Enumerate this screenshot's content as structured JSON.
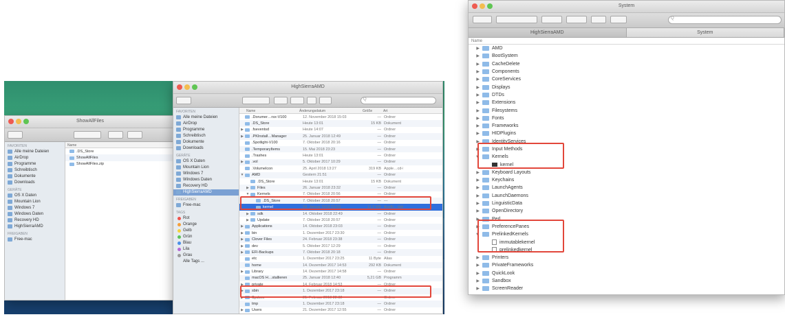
{
  "left_screenshot": {
    "window_small": {
      "title": "ShowAllFiles",
      "sidebar_headers": [
        "FAVORITEN",
        "GERÄTE",
        "FREIGABEN"
      ],
      "favorites": [
        "Alle meine Dateien",
        "AirDrop",
        "Programme",
        "Schreibtisch",
        "Dokumente",
        "Downloads"
      ],
      "devices": [
        "OS X Daten",
        "Mountain Lion",
        "Windows 7",
        "Windows Daten",
        "Recovery HD",
        "HighSierraAMD"
      ],
      "shared": [
        "Free-mac"
      ],
      "list_header": "Name",
      "files": [
        ".DS_Store",
        "ShowAllFiles",
        "ShowAllFiles.zip"
      ]
    },
    "window_main": {
      "title": "HighSierraAMD",
      "search_placeholder": "Q",
      "sidebar_headers": [
        "FAVORITEN",
        "GERÄTE",
        "FREIGABEN",
        "TAGS"
      ],
      "favorites": [
        "Alle meine Dateien",
        "AirDrop",
        "Programme",
        "Schreibtisch",
        "Dokumente",
        "Downloads"
      ],
      "devices": [
        "OS X Daten",
        "Mountain Lion",
        "Windows 7",
        "Windows Daten",
        "Recovery HD",
        "HighSierraAMD"
      ],
      "shared": [
        "Free-mac"
      ],
      "tags": [
        {
          "label": "Rot",
          "color": "#f0524a"
        },
        {
          "label": "Orange",
          "color": "#f5a03a"
        },
        {
          "label": "Gelb",
          "color": "#f3d13d"
        },
        {
          "label": "Grün",
          "color": "#5cc35a"
        },
        {
          "label": "Blau",
          "color": "#4a8fe7"
        },
        {
          "label": "Lila",
          "color": "#b569d6"
        },
        {
          "label": "Grau",
          "color": "#9a9a9a"
        },
        {
          "label": "Alle Tags ...",
          "color": ""
        }
      ],
      "columns": [
        "Name",
        "Änderungsdatum",
        "Größe",
        "Art"
      ],
      "rows": [
        {
          "name": ".Dorumer…rsx-V100",
          "date": "12. November 2018 15:03",
          "size": "—",
          "kind": "Ordner",
          "disclosure": ""
        },
        {
          "name": ".DS_Store",
          "date": "Heute 13:01",
          "size": "15 KB",
          "kind": "Dokument",
          "disclosure": ""
        },
        {
          "name": ".fseventsd",
          "date": "Heute 14:07",
          "size": "—",
          "kind": "Ordner",
          "disclosure": "▶"
        },
        {
          "name": ".PKInstall…Manager",
          "date": "25. Januar 2018 12:49",
          "size": "—",
          "kind": "Ordner",
          "disclosure": "▶"
        },
        {
          "name": ".Spotlight-V100",
          "date": "7. Oktober 2018 20:16",
          "size": "—",
          "kind": "Ordner",
          "disclosure": ""
        },
        {
          "name": ".TemporaryItems",
          "date": "15. Mai 2018 23:23",
          "size": "—",
          "kind": "Ordner",
          "disclosure": ""
        },
        {
          "name": ".Trashes",
          "date": "Heute 13:01",
          "size": "—",
          "kind": "Ordner",
          "disclosure": ""
        },
        {
          "name": ".vol",
          "date": "5. Oktober 2017 10:29",
          "size": "—",
          "kind": "Ordner",
          "disclosure": "▶"
        },
        {
          "name": ".VolumeIcon",
          "date": "25. April 2018 13:27",
          "size": "319 KB",
          "kind": "Apple…cd-Bild",
          "disclosure": ""
        },
        {
          "name": "AMD",
          "date": "Gestern 21:51",
          "size": "—",
          "kind": "Ordner",
          "disclosure": "▼"
        },
        {
          "name": ".DS_Store",
          "date": "Heute 13:01",
          "size": "15 KB",
          "kind": "Dokument",
          "disclosure": ""
        },
        {
          "name": "Files",
          "date": "26. Januar 2018 23:32",
          "size": "—",
          "kind": "Ordner",
          "disclosure": "▶"
        },
        {
          "name": "Kernels",
          "date": "7. Oktober 2018 20:56",
          "size": "—",
          "kind": "Ordner",
          "disclosure": "▼"
        },
        {
          "name": ".DS_Store",
          "date": "7. Oktober 2018 20:57",
          "size": "—",
          "kind": "—",
          "disclosure": ""
        },
        {
          "name": "kernel",
          "date": "24. Januar 2018 12:03",
          "size": "11,3 MB",
          "kind": "Ausfü…datei",
          "disclosure": "",
          "highlight": true
        },
        {
          "name": "sdk",
          "date": "14. Oktober 2018 22:49",
          "size": "—",
          "kind": "Ordner",
          "disclosure": "▶"
        },
        {
          "name": "Update",
          "date": "7. Oktober 2018 20:57",
          "size": "—",
          "kind": "Ordner",
          "disclosure": "▶"
        },
        {
          "name": "Applications",
          "date": "14. Oktober 2018 23:03",
          "size": "—",
          "kind": "Ordner",
          "disclosure": "▶"
        },
        {
          "name": "bin",
          "date": "1. Dezember 2017 23:30",
          "size": "—",
          "kind": "Ordner",
          "disclosure": "▶"
        },
        {
          "name": "Clover Files",
          "date": "24. Februar 2018 23:38",
          "size": "—",
          "kind": "Ordner",
          "disclosure": "▶"
        },
        {
          "name": "dev",
          "date": "5. Oktober 2017 12:29",
          "size": "—",
          "kind": "Ordner",
          "disclosure": "▶"
        },
        {
          "name": "EFI-Backups",
          "date": "7. Oktober 2018 20:18",
          "size": "—",
          "kind": "Ordner",
          "disclosure": "▶"
        },
        {
          "name": "etc",
          "date": "1. Dezember 2017 23:25",
          "size": "11 Byte",
          "kind": "Alias",
          "disclosure": ""
        },
        {
          "name": "home",
          "date": "14. Dezember 2017 14:53",
          "size": "292 KB",
          "kind": "Dokument",
          "disclosure": ""
        },
        {
          "name": "Library",
          "date": "14. Dezember 2017 14:58",
          "size": "—",
          "kind": "Ordner",
          "disclosure": "▶"
        },
        {
          "name": "macOS H…stallieren",
          "date": "25. Januar 2018 12:40",
          "size": "5,21 GB",
          "kind": "Programm",
          "disclosure": ""
        },
        {
          "name": "private",
          "date": "14. Februar 2018 14:53",
          "size": "—",
          "kind": "Ordner",
          "disclosure": "▶"
        },
        {
          "name": "sbin",
          "date": "1. Dezember 2017 23:18",
          "size": "—",
          "kind": "Ordner",
          "disclosure": "▶"
        },
        {
          "name": "System",
          "date": "21. Februar 2018 22:32",
          "size": "—",
          "kind": "Ordner",
          "disclosure": "▶"
        },
        {
          "name": "tmp",
          "date": "1. Dezember 2017 23:18",
          "size": "—",
          "kind": "Ordner",
          "disclosure": ""
        },
        {
          "name": "Users",
          "date": "21. Dezember 2017 12:55",
          "size": "—",
          "kind": "Ordner",
          "disclosure": "▶"
        }
      ]
    }
  },
  "right_screenshot": {
    "title": "System",
    "search_placeholder": "Q",
    "tabs": [
      "HighSierraAMD",
      "System"
    ],
    "list_header": "Name",
    "items": [
      {
        "name": "AMD",
        "level": 0,
        "disclosure": "▶",
        "type": "folder"
      },
      {
        "name": "BootSystem",
        "level": 0,
        "disclosure": "▶",
        "type": "folder"
      },
      {
        "name": "CacheDelete",
        "level": 0,
        "disclosure": "▶",
        "type": "folder"
      },
      {
        "name": "Components",
        "level": 0,
        "disclosure": "▶",
        "type": "folder"
      },
      {
        "name": "CoreServices",
        "level": 0,
        "disclosure": "▶",
        "type": "folder"
      },
      {
        "name": "Displays",
        "level": 0,
        "disclosure": "▶",
        "type": "folder"
      },
      {
        "name": "DTDs",
        "level": 0,
        "disclosure": "▶",
        "type": "folder"
      },
      {
        "name": "Extensions",
        "level": 0,
        "disclosure": "▶",
        "type": "folder"
      },
      {
        "name": "Filesystems",
        "level": 0,
        "disclosure": "▶",
        "type": "folder"
      },
      {
        "name": "Fonts",
        "level": 0,
        "disclosure": "▶",
        "type": "folder"
      },
      {
        "name": "Frameworks",
        "level": 0,
        "disclosure": "▶",
        "type": "folder"
      },
      {
        "name": "HIDPlugins",
        "level": 0,
        "disclosure": "▶",
        "type": "folder"
      },
      {
        "name": "IdentityServices",
        "level": 0,
        "disclosure": "▶",
        "type": "folder"
      },
      {
        "name": "Input Methods",
        "level": 0,
        "disclosure": "▶",
        "type": "folder"
      },
      {
        "name": "Kernels",
        "level": 0,
        "disclosure": "▼",
        "type": "folder"
      },
      {
        "name": "kernel",
        "level": 1,
        "disclosure": "",
        "type": "exec"
      },
      {
        "name": "Keyboard Layouts",
        "level": 0,
        "disclosure": "▶",
        "type": "folder"
      },
      {
        "name": "Keychains",
        "level": 0,
        "disclosure": "▶",
        "type": "folder"
      },
      {
        "name": "LaunchAgents",
        "level": 0,
        "disclosure": "▶",
        "type": "folder"
      },
      {
        "name": "LaunchDaemons",
        "level": 0,
        "disclosure": "▶",
        "type": "folder"
      },
      {
        "name": "LinguisticData",
        "level": 0,
        "disclosure": "▶",
        "type": "folder"
      },
      {
        "name": "OpenDirectory",
        "level": 0,
        "disclosure": "▶",
        "type": "folder"
      },
      {
        "name": "Perl",
        "level": 0,
        "disclosure": "▶",
        "type": "folder"
      },
      {
        "name": "PreferencePanes",
        "level": 0,
        "disclosure": "▶",
        "type": "folder"
      },
      {
        "name": "PrelinkedKernels",
        "level": 0,
        "disclosure": "▼",
        "type": "folder"
      },
      {
        "name": "immutablekernel",
        "level": 1,
        "disclosure": "",
        "type": "doc"
      },
      {
        "name": "prelinkedkernel",
        "level": 1,
        "disclosure": "",
        "type": "doc"
      },
      {
        "name": "Printers",
        "level": 0,
        "disclosure": "▶",
        "type": "folder"
      },
      {
        "name": "PrivateFrameworks",
        "level": 0,
        "disclosure": "▶",
        "type": "folder"
      },
      {
        "name": "QuickLook",
        "level": 0,
        "disclosure": "▶",
        "type": "folder"
      },
      {
        "name": "Sandbox",
        "level": 0,
        "disclosure": "▶",
        "type": "folder"
      },
      {
        "name": "ScreenReader",
        "level": 0,
        "disclosure": "▶",
        "type": "folder"
      }
    ]
  },
  "colors": {
    "highlight_box": "#e2463a",
    "selection": "#2f6fdc"
  }
}
